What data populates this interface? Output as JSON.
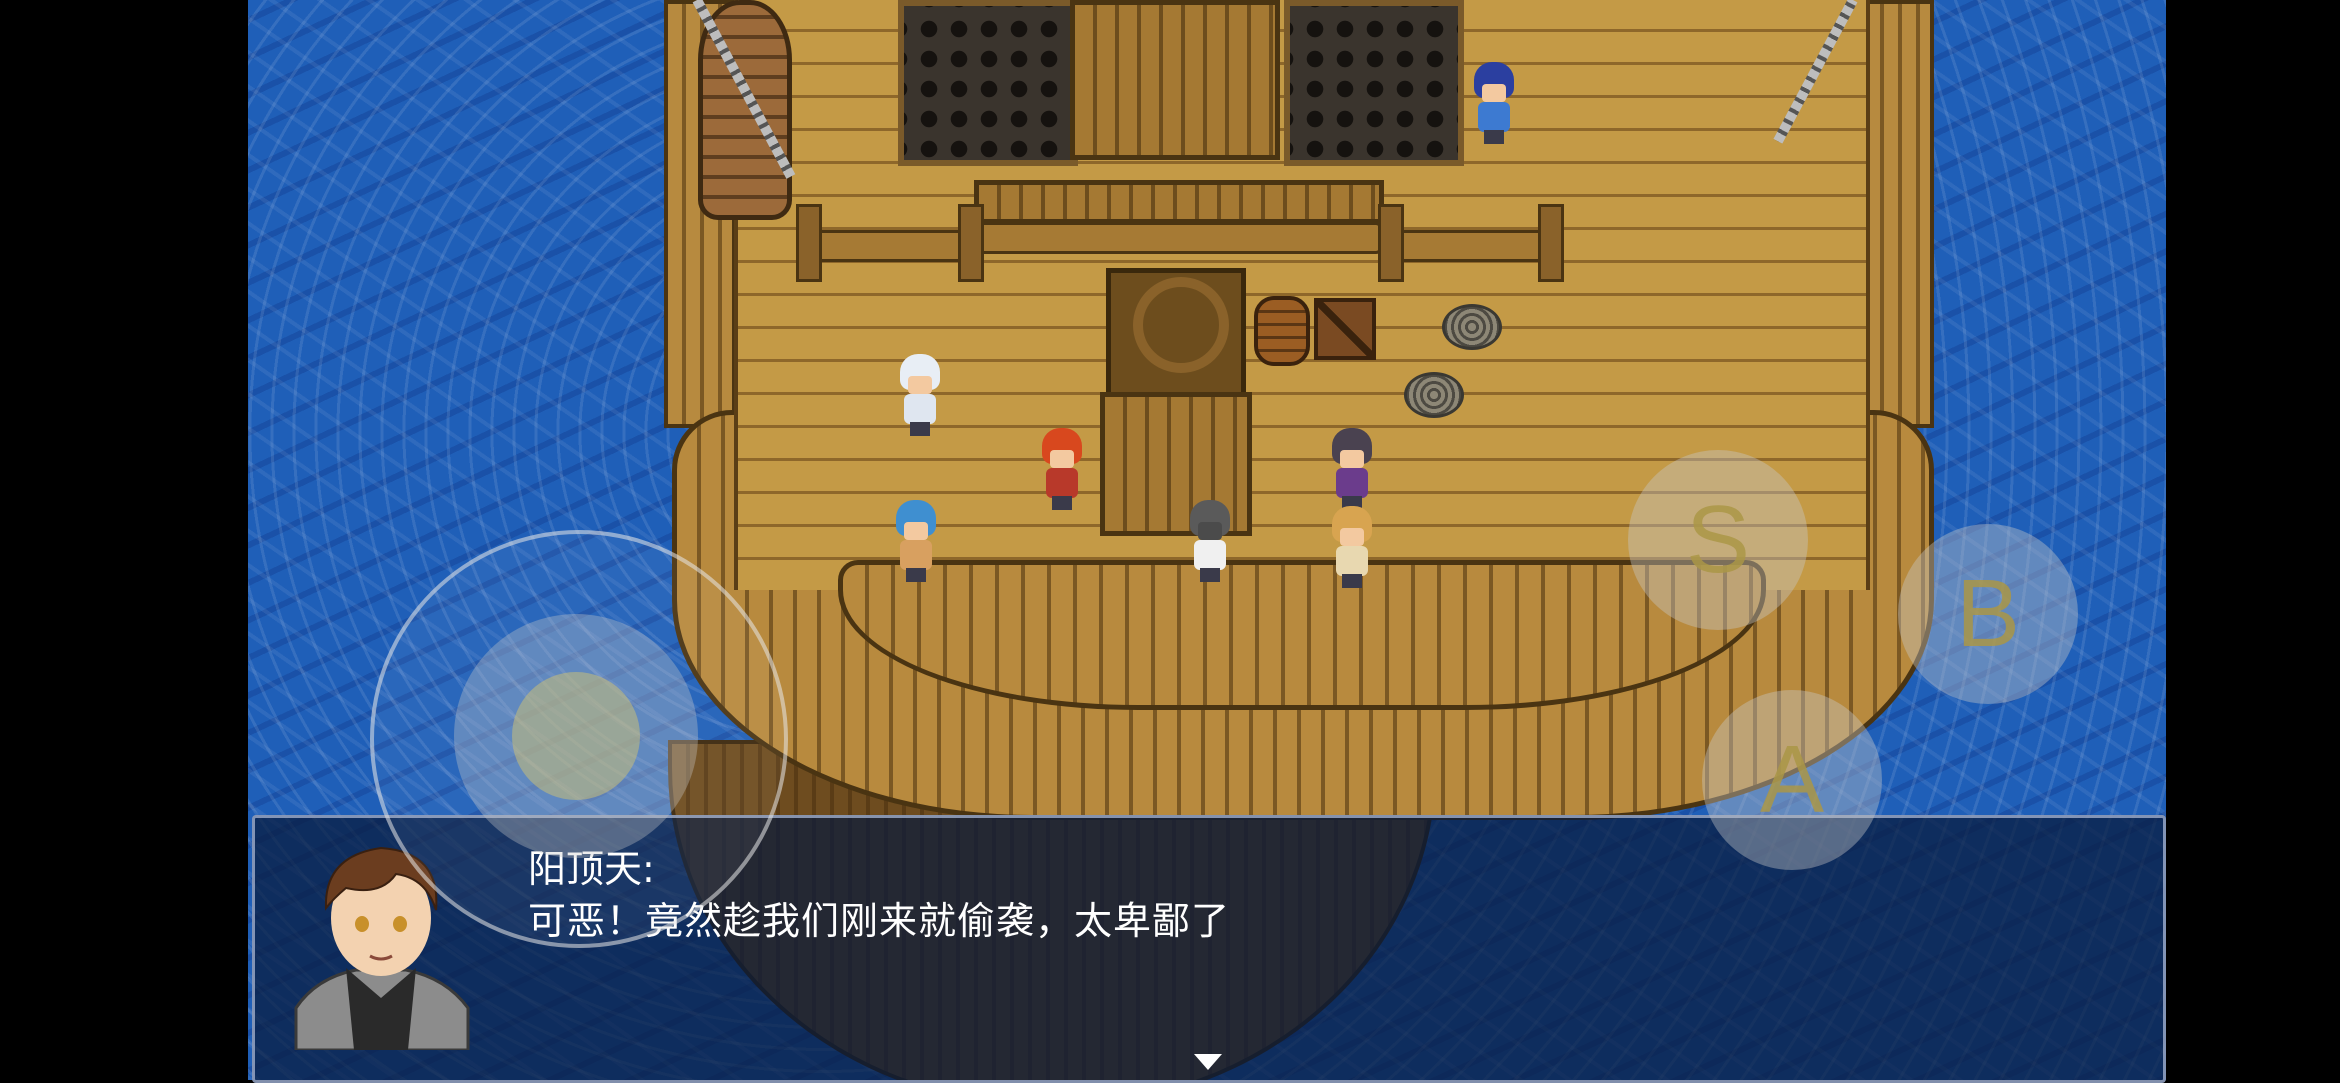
{
  "dialog": {
    "speaker": "阳顶天:",
    "text": "可恶！竟然趁我们刚来就偷袭，太卑鄙了"
  },
  "controls": {
    "s_label": "S",
    "b_label": "B",
    "a_label": "A"
  },
  "icons": {
    "joystick": "virtual-joystick",
    "advance": "triangle-down-icon"
  },
  "colors": {
    "sea": "#1f5fb8",
    "deck": "#c49a46",
    "dialog_bg": "#081a3c"
  }
}
